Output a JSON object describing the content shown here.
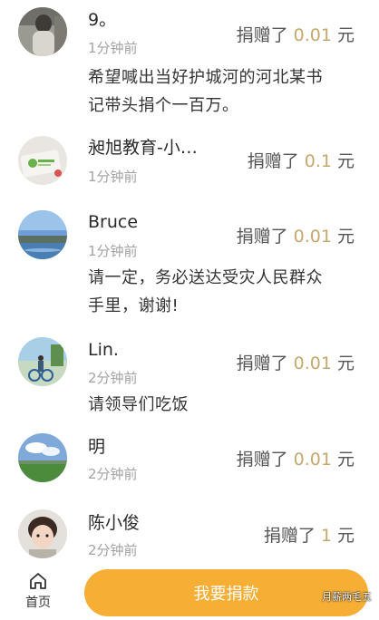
{
  "donations": [
    {
      "name": "9。",
      "time": "1分钟前",
      "amount_prefix": "捐赠了 ",
      "amount": "0.01",
      "amount_unit": " 元",
      "message_lines": [
        "希望喊出当好护城河的河北某书",
        "记带头捐个一百万。"
      ]
    },
    {
      "name": "昶旭教育-小…",
      "time": "1分钟前",
      "amount_prefix": "捐赠了 ",
      "amount": "0.1",
      "amount_unit": " 元",
      "message_lines": []
    },
    {
      "name": "Bruce",
      "time": "1分钟前",
      "amount_prefix": "捐赠了 ",
      "amount": "0.01",
      "amount_unit": " 元",
      "message_lines": [
        "请一定，务必送达受灾人民群众",
        "手里，谢谢!"
      ]
    },
    {
      "name": "Lin.",
      "time": "2分钟前",
      "amount_prefix": "捐赠了 ",
      "amount": "0.01",
      "amount_unit": " 元",
      "message_lines": [
        "请领导们吃饭"
      ]
    },
    {
      "name": "明",
      "time": "2分钟前",
      "amount_prefix": "捐赠了 ",
      "amount": "0.01",
      "amount_unit": " 元",
      "message_lines": []
    },
    {
      "name": "陈小俊",
      "time": "2分钟前",
      "amount_prefix": "捐赠了 ",
      "amount": "1",
      "amount_unit": " 元",
      "message_lines": []
    }
  ],
  "footer": {
    "home_label": "首页",
    "donate_button_label": "我要捐款"
  },
  "watermark": "月薪两毛五",
  "colors": {
    "accent": "#f7ae34",
    "amount": "#c6a76d"
  }
}
